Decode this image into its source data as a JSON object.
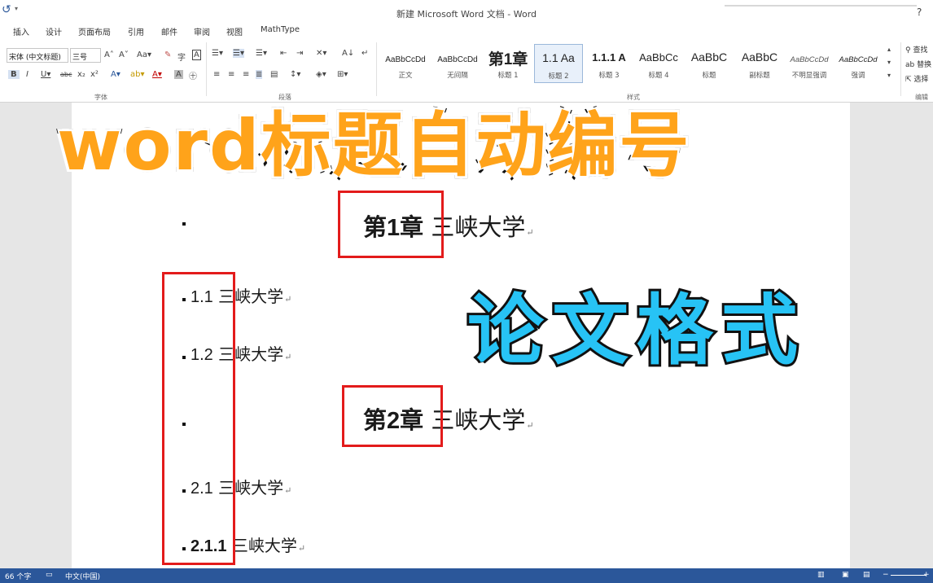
{
  "window": {
    "title": "新建 Microsoft Word 文档 - Word",
    "help": "?"
  },
  "tabs": [
    "插入",
    "设计",
    "页面布局",
    "引用",
    "邮件",
    "审阅",
    "视图",
    "MathType"
  ],
  "ribbon": {
    "font_name": "宋体 (中文标题)",
    "font_size": "三号",
    "font_group_label": "字体",
    "paragraph_group_label": "段落",
    "styles_group_label": "样式",
    "editing_group_label": "编辑",
    "find_label": "查找",
    "replace_label": "替换",
    "select_label": "选择",
    "styles": [
      {
        "preview": "AaBbCcDd",
        "name": "正文"
      },
      {
        "preview": "AaBbCcDd",
        "name": "无间隔"
      },
      {
        "preview": "第1章",
        "name": "标题 1"
      },
      {
        "preview": "1.1  Aa",
        "name": "标题 2"
      },
      {
        "preview": "1.1.1 A",
        "name": "标题 3"
      },
      {
        "preview": "AaBbCc",
        "name": "标题 4"
      },
      {
        "preview": "AaBbC",
        "name": "标题"
      },
      {
        "preview": "AaBbC",
        "name": "副标题"
      },
      {
        "preview": "AaBbCcDd",
        "name": "不明显强调"
      },
      {
        "preview": "AaBbCcDd",
        "name": "强调"
      }
    ]
  },
  "document": {
    "headings": [
      {
        "num": "第1章",
        "text": "三峡大学"
      },
      {
        "num": "1.1",
        "text": "三峡大学"
      },
      {
        "num": "1.2",
        "text": "三峡大学"
      },
      {
        "num": "第2章",
        "text": "三峡大学"
      },
      {
        "num": "2.1",
        "text": "三峡大学"
      },
      {
        "num": "2.1.1",
        "text": "三峡大学"
      }
    ],
    "paragraph_mark": "↵"
  },
  "overlay": {
    "title": "word标题自动编号",
    "subtitle": "论文格式"
  },
  "status": {
    "word_count": "66 个字",
    "language": "中文(中国)"
  },
  "colors": {
    "accent": "#2b579a",
    "highlight_box": "#e31b1b",
    "overlay_title": "#ffa31a",
    "overlay_sub": "#27c3f5"
  }
}
